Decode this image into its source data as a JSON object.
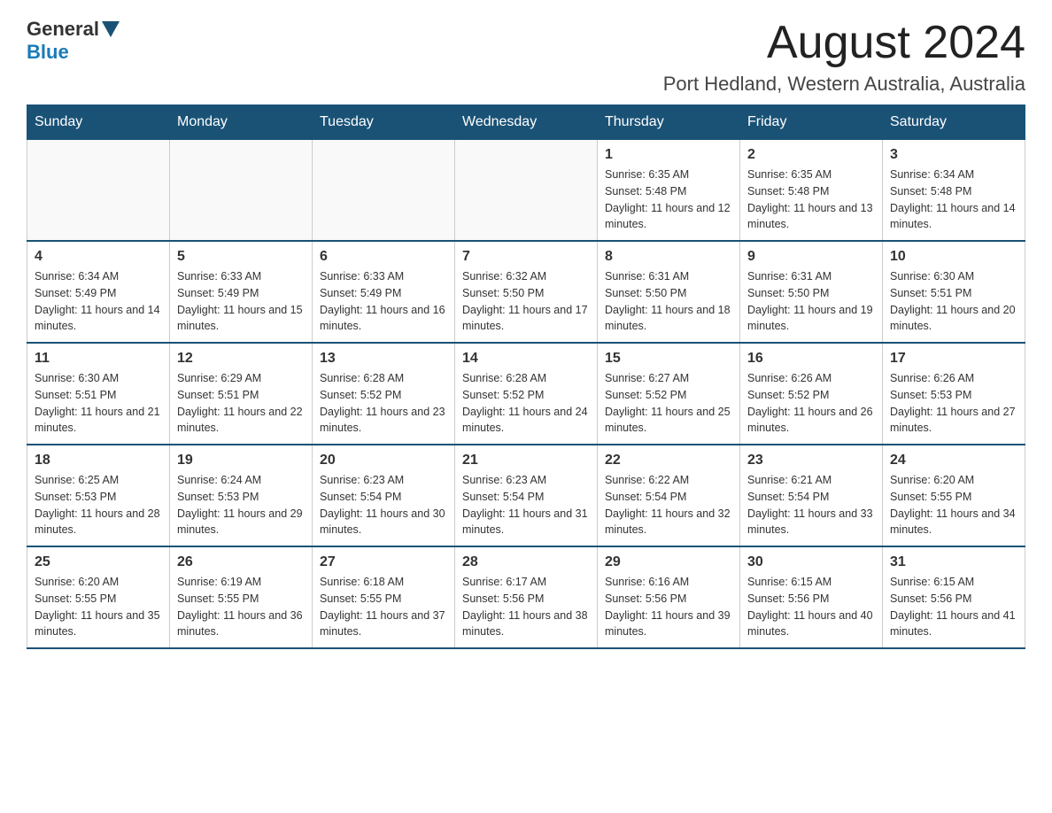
{
  "logo": {
    "general": "General",
    "blue": "Blue"
  },
  "title": "August 2024",
  "location": "Port Hedland, Western Australia, Australia",
  "headers": [
    "Sunday",
    "Monday",
    "Tuesday",
    "Wednesday",
    "Thursday",
    "Friday",
    "Saturday"
  ],
  "weeks": [
    [
      {
        "day": "",
        "info": ""
      },
      {
        "day": "",
        "info": ""
      },
      {
        "day": "",
        "info": ""
      },
      {
        "day": "",
        "info": ""
      },
      {
        "day": "1",
        "info": "Sunrise: 6:35 AM\nSunset: 5:48 PM\nDaylight: 11 hours and 12 minutes."
      },
      {
        "day": "2",
        "info": "Sunrise: 6:35 AM\nSunset: 5:48 PM\nDaylight: 11 hours and 13 minutes."
      },
      {
        "day": "3",
        "info": "Sunrise: 6:34 AM\nSunset: 5:48 PM\nDaylight: 11 hours and 14 minutes."
      }
    ],
    [
      {
        "day": "4",
        "info": "Sunrise: 6:34 AM\nSunset: 5:49 PM\nDaylight: 11 hours and 14 minutes."
      },
      {
        "day": "5",
        "info": "Sunrise: 6:33 AM\nSunset: 5:49 PM\nDaylight: 11 hours and 15 minutes."
      },
      {
        "day": "6",
        "info": "Sunrise: 6:33 AM\nSunset: 5:49 PM\nDaylight: 11 hours and 16 minutes."
      },
      {
        "day": "7",
        "info": "Sunrise: 6:32 AM\nSunset: 5:50 PM\nDaylight: 11 hours and 17 minutes."
      },
      {
        "day": "8",
        "info": "Sunrise: 6:31 AM\nSunset: 5:50 PM\nDaylight: 11 hours and 18 minutes."
      },
      {
        "day": "9",
        "info": "Sunrise: 6:31 AM\nSunset: 5:50 PM\nDaylight: 11 hours and 19 minutes."
      },
      {
        "day": "10",
        "info": "Sunrise: 6:30 AM\nSunset: 5:51 PM\nDaylight: 11 hours and 20 minutes."
      }
    ],
    [
      {
        "day": "11",
        "info": "Sunrise: 6:30 AM\nSunset: 5:51 PM\nDaylight: 11 hours and 21 minutes."
      },
      {
        "day": "12",
        "info": "Sunrise: 6:29 AM\nSunset: 5:51 PM\nDaylight: 11 hours and 22 minutes."
      },
      {
        "day": "13",
        "info": "Sunrise: 6:28 AM\nSunset: 5:52 PM\nDaylight: 11 hours and 23 minutes."
      },
      {
        "day": "14",
        "info": "Sunrise: 6:28 AM\nSunset: 5:52 PM\nDaylight: 11 hours and 24 minutes."
      },
      {
        "day": "15",
        "info": "Sunrise: 6:27 AM\nSunset: 5:52 PM\nDaylight: 11 hours and 25 minutes."
      },
      {
        "day": "16",
        "info": "Sunrise: 6:26 AM\nSunset: 5:52 PM\nDaylight: 11 hours and 26 minutes."
      },
      {
        "day": "17",
        "info": "Sunrise: 6:26 AM\nSunset: 5:53 PM\nDaylight: 11 hours and 27 minutes."
      }
    ],
    [
      {
        "day": "18",
        "info": "Sunrise: 6:25 AM\nSunset: 5:53 PM\nDaylight: 11 hours and 28 minutes."
      },
      {
        "day": "19",
        "info": "Sunrise: 6:24 AM\nSunset: 5:53 PM\nDaylight: 11 hours and 29 minutes."
      },
      {
        "day": "20",
        "info": "Sunrise: 6:23 AM\nSunset: 5:54 PM\nDaylight: 11 hours and 30 minutes."
      },
      {
        "day": "21",
        "info": "Sunrise: 6:23 AM\nSunset: 5:54 PM\nDaylight: 11 hours and 31 minutes."
      },
      {
        "day": "22",
        "info": "Sunrise: 6:22 AM\nSunset: 5:54 PM\nDaylight: 11 hours and 32 minutes."
      },
      {
        "day": "23",
        "info": "Sunrise: 6:21 AM\nSunset: 5:54 PM\nDaylight: 11 hours and 33 minutes."
      },
      {
        "day": "24",
        "info": "Sunrise: 6:20 AM\nSunset: 5:55 PM\nDaylight: 11 hours and 34 minutes."
      }
    ],
    [
      {
        "day": "25",
        "info": "Sunrise: 6:20 AM\nSunset: 5:55 PM\nDaylight: 11 hours and 35 minutes."
      },
      {
        "day": "26",
        "info": "Sunrise: 6:19 AM\nSunset: 5:55 PM\nDaylight: 11 hours and 36 minutes."
      },
      {
        "day": "27",
        "info": "Sunrise: 6:18 AM\nSunset: 5:55 PM\nDaylight: 11 hours and 37 minutes."
      },
      {
        "day": "28",
        "info": "Sunrise: 6:17 AM\nSunset: 5:56 PM\nDaylight: 11 hours and 38 minutes."
      },
      {
        "day": "29",
        "info": "Sunrise: 6:16 AM\nSunset: 5:56 PM\nDaylight: 11 hours and 39 minutes."
      },
      {
        "day": "30",
        "info": "Sunrise: 6:15 AM\nSunset: 5:56 PM\nDaylight: 11 hours and 40 minutes."
      },
      {
        "day": "31",
        "info": "Sunrise: 6:15 AM\nSunset: 5:56 PM\nDaylight: 11 hours and 41 minutes."
      }
    ]
  ]
}
